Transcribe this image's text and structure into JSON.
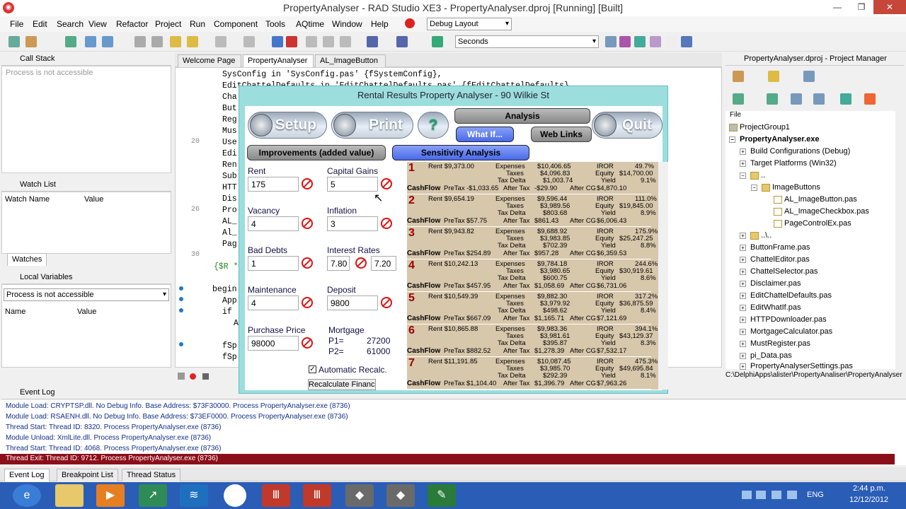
{
  "window": {
    "title": "PropertyAnalyser - RAD Studio XE3 - PropertyAnalyser.dproj [Running] [Built]"
  },
  "menu": [
    "File",
    "Edit",
    "Search",
    "View",
    "Refactor",
    "Project",
    "Run",
    "Component",
    "Tools",
    "AQtime",
    "Window",
    "Help"
  ],
  "toolbar": {
    "layout": "Debug Layout",
    "units": "Seconds"
  },
  "left": {
    "callstack_title": "Call Stack",
    "callstack_msg": "Process is not accessible",
    "watch_title": "Watch List",
    "watch_col1": "Watch Name",
    "watch_col2": "Value",
    "watches_tab": "Watches",
    "locals_title": "Local Variables",
    "locals_combo": "Process is not accessible",
    "locals_col1": "Name",
    "locals_col2": "Value"
  },
  "tabs": [
    "Welcome Page",
    "PropertyAnalyser",
    "AL_ImageButton"
  ],
  "code": [
    "SysConfig in 'SysConfig.pas' {fSystemConfig},",
    "EditChattelDefaults in 'EditChattelDefaults.pas' {fEditChattelDefaults},",
    "Cha",
    "But",
    "Reg",
    "Mus",
    "Use",
    "Edi",
    "Ren",
    "Sub",
    "HTT",
    "Dis",
    "Pro",
    "AL_",
    "Al_",
    "Pag",
    "",
    "{$R *",
    "",
    "begin",
    "App",
    "if",
    "A",
    "",
    "fSp",
    "fSp"
  ],
  "lines": {
    "l20": "20",
    "l26": "26",
    "l30": "30"
  },
  "dialog": {
    "title": "Rental Results Property Analyser - 90 Wilkie St",
    "setup": "Setup",
    "print": "Print",
    "help": "?",
    "analysis": "Analysis",
    "whatif": "What If...",
    "weblinks": "Web Links",
    "quit": "Quit",
    "improvements": "Improvements (added value)",
    "sensitivity": "Sensitivity Analysis",
    "fields": {
      "rent_l": "Rent",
      "rent_v": "175",
      "cg_l": "Capital Gains",
      "cg_v": "5",
      "vac_l": "Vacancy",
      "vac_v": "4",
      "inf_l": "Inflation",
      "inf_v": "3",
      "bd_l": "Bad Debts",
      "bd_v": "1",
      "ir_l": "Interest Rates",
      "ir_v1": "7.80",
      "ir_v2": "7.20",
      "mt_l": "Maintenance",
      "mt_v": "4",
      "dep_l": "Deposit",
      "dep_v": "9800",
      "pp_l": "Purchase Price",
      "pp_v": "98000",
      "mort_l": "Mortgage",
      "p1_l": "P1=",
      "p1_v": "27200",
      "p2_l": "P2=",
      "p2_v": "61000",
      "auto": "Automatic Recalc.",
      "recalc": "Recalculate Financials"
    },
    "results": [
      {
        "n": "1",
        "rent": "Rent  $9,373.00",
        "exp": "$10,406.65",
        "tax": "$4,096.83",
        "td": "$1,003.74",
        "iror": "49.7%",
        "eq": "$14,700.00",
        "yield": "9.1%",
        "pre": "-$1,033.65",
        "after": "-$29.90",
        "acg": "$4,870.10"
      },
      {
        "n": "2",
        "rent": "Rent  $9,654.19",
        "exp": "$9,596.44",
        "tax": "$3,989.56",
        "td": "$803.68",
        "iror": "111.0%",
        "eq": "$19,845.00",
        "yield": "8.9%",
        "pre": "$57.75",
        "after": "$861.43",
        "acg": "$6,006.43"
      },
      {
        "n": "3",
        "rent": "Rent  $9,943.82",
        "exp": "$9,688.92",
        "tax": "$3,983.85",
        "td": "$702.39",
        "iror": "175.9%",
        "eq": "$25,247.25",
        "yield": "8.8%",
        "pre": "$254.89",
        "after": "$957.28",
        "acg": "$6,359.53"
      },
      {
        "n": "4",
        "rent": "Rent  $10,242.13",
        "exp": "$9,784.18",
        "tax": "$3,980.65",
        "td": "$600.75",
        "iror": "244.6%",
        "eq": "$30,919.61",
        "yield": "8.6%",
        "pre": "$457.95",
        "after": "$1,058.69",
        "acg": "$6,731.06"
      },
      {
        "n": "5",
        "rent": "Rent  $10,549.39",
        "exp": "$9,882.30",
        "tax": "$3,979.92",
        "td": "$498.62",
        "iror": "317.2%",
        "eq": "$36,875.59",
        "yield": "8.4%",
        "pre": "$667.09",
        "after": "$1,165.71",
        "acg": "$7,121.69"
      },
      {
        "n": "6",
        "rent": "Rent  $10,865.88",
        "exp": "$9,983.36",
        "tax": "$3,981.61",
        "td": "$395.87",
        "iror": "394.1%",
        "eq": "$43,129.37",
        "yield": "8.3%",
        "pre": "$882.52",
        "after": "$1,278.39",
        "acg": "$7,532.17"
      },
      {
        "n": "7",
        "rent": "Rent  $11,191.85",
        "exp": "$10,087.45",
        "tax": "$3,985.70",
        "td": "$292.39",
        "iror": "475.3%",
        "eq": "$49,695.84",
        "yield": "8.1%",
        "pre": "$1,104.40",
        "after": "$1,396.79",
        "acg": "$7,963.26"
      }
    ],
    "res_labels": {
      "expenses": "Expenses",
      "taxes": "Taxes",
      "taxdelta": "Tax Delta",
      "iror": "IROR",
      "equity": "Equity",
      "yield": "Yield",
      "cashflow": "CashFlow",
      "pretax": "PreTax",
      "aftertax": "After Tax",
      "aftercg": "After CG"
    }
  },
  "pm": {
    "title": "PropertyAnalyser.dproj - Project Manager",
    "file_col": "File",
    "status_path": "C:\\DelphiApps\\alister\\PropertyAnaliser\\PropertyAnalyser",
    "nodes": [
      "ProjectGroup1",
      "PropertyAnalyser.exe",
      "Build Configurations (Debug)",
      "Target Platforms (Win32)",
      "..",
      "ImageButtons",
      "AL_ImageButton.pas",
      "AL_ImageCheckbox.pas",
      "PageControlEx.pas",
      "..\\..",
      "ButtonFrame.pas",
      "ChattelEditor.pas",
      "ChattelSelector.pas",
      "Disclaimer.pas",
      "EditChattelDefaults.pas",
      "EditWhatIf.pas",
      "HTTPDownloader.pas",
      "MortgageCalculator.pas",
      "MustRegister.pas",
      "pi_Data.pas",
      "PropertyAnalyserSettings.pas"
    ]
  },
  "eventlog": {
    "title": "Event Log",
    "lines": [
      "Module Load: CRYPTSP.dll. No Debug Info. Base Address: $73F30000. Process PropertyAnalyser.exe (8736)",
      "Module Load: RSAENH.dll. No Debug Info. Base Address: $73EF0000. Process PropertyAnalyser.exe (8736)",
      "Thread Start: Thread ID: 8320. Process PropertyAnalyser.exe (8736)",
      "Module Unload: XmlLite.dll. Process PropertyAnalyser.exe (8736)",
      "Thread Start: Thread ID: 4068. Process PropertyAnalyser.exe (8736)"
    ],
    "selected": "Thread Exit: Thread ID: 9712. Process PropertyAnalyser.exe (8736)"
  },
  "bottomtabs": [
    "Event Log",
    "Breakpoint List",
    "Thread Status"
  ],
  "tray": {
    "lang": "ENG",
    "time": "2:44 p.m.",
    "date": "12/12/2012"
  }
}
